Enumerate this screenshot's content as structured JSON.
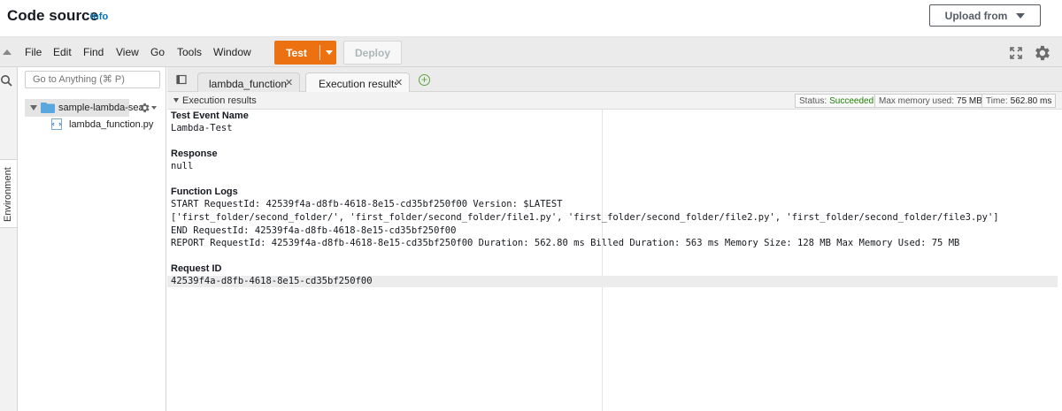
{
  "header": {
    "title": "Code source",
    "info_link": "Info",
    "upload_button": "Upload from"
  },
  "menu": {
    "items": [
      "File",
      "Edit",
      "Find",
      "View",
      "Go",
      "Tools",
      "Window"
    ],
    "test_button": "Test",
    "deploy_button": "Deploy"
  },
  "left_strip": {
    "environment_tab": "Environment"
  },
  "file_tree": {
    "search_placeholder": "Go to Anything (⌘ P)",
    "root_folder": "sample-lambda-sea",
    "files": [
      "lambda_function.py"
    ]
  },
  "tabs": [
    {
      "label": "lambda_function",
      "active": false
    },
    {
      "label": "Execution results",
      "active": true
    }
  ],
  "results": {
    "title": "Execution results",
    "status_label": "Status:",
    "status_value": "Succeeded",
    "memory_label": "Max memory used:",
    "memory_value": "75 MB",
    "time_label": "Time:",
    "time_value": "562.80 ms",
    "test_event_heading": "Test Event Name",
    "test_event_value": "Lambda-Test",
    "response_heading": "Response",
    "response_value": "null",
    "logs_heading": "Function Logs",
    "logs": [
      "START RequestId: 42539f4a-d8fb-4618-8e15-cd35bf250f00 Version: $LATEST",
      "['first_folder/second_folder/', 'first_folder/second_folder/file1.py', 'first_folder/second_folder/file2.py', 'first_folder/second_folder/file3.py']",
      "END RequestId: 42539f4a-d8fb-4618-8e15-cd35bf250f00",
      "REPORT RequestId: 42539f4a-d8fb-4618-8e15-cd35bf250f00  Duration: 562.80 ms Billed Duration: 563 ms Memory Size: 128 MB Max Memory Used: 75 MB"
    ],
    "request_id_heading": "Request ID",
    "request_id_value": "42539f4a-d8fb-4618-8e15-cd35bf250f00"
  },
  "colors": {
    "accent": "#ec7211",
    "link": "#0073bb",
    "success": "#1d8102"
  }
}
